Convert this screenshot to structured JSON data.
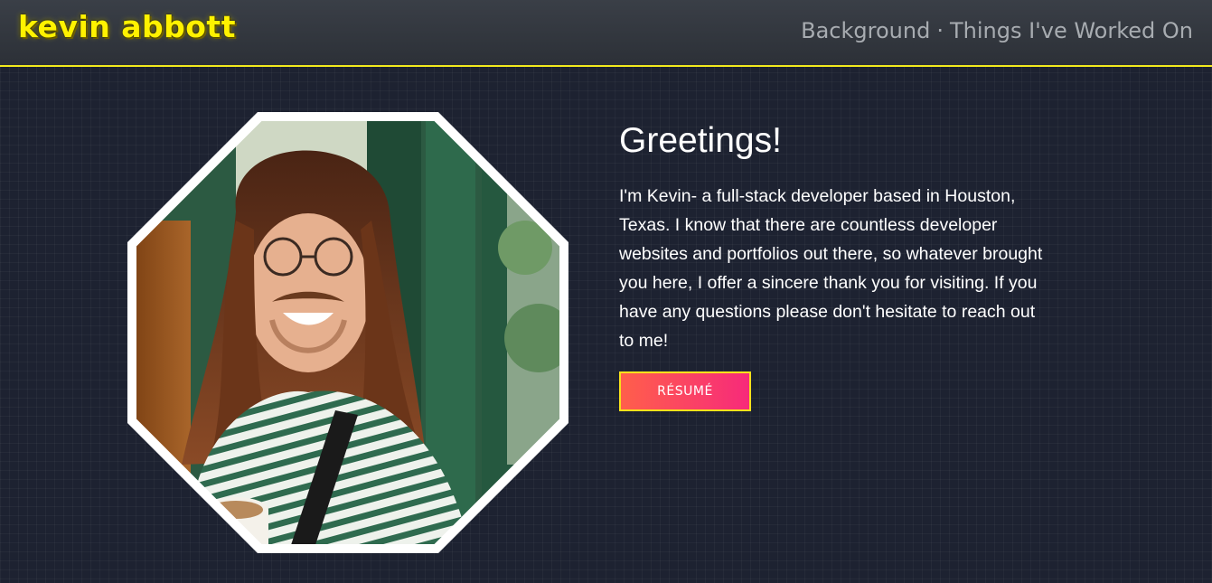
{
  "header": {
    "logo_text": "kevin abbott",
    "nav": {
      "items": [
        {
          "label": "Background"
        },
        {
          "label": "Things I've Worked On"
        }
      ],
      "separator": "·"
    }
  },
  "main": {
    "photo": {
      "description": "octagonal-profile-photo"
    },
    "greeting": "Greetings!",
    "intro": "I'm Kevin- a full-stack developer based in Houston, Texas. I know that there are countless developer websites and portfolios out there, so whatever brought you here, I offer a sincere thank you for visiting. If you have any questions please don't hesitate to reach out to me!",
    "resume_button": "RÉSUMÉ"
  },
  "colors": {
    "accent_yellow": "#f2ea1d",
    "background": "#1d2231",
    "button_gradient_start": "#ff5f4b",
    "button_gradient_end": "#f72a7a",
    "nav_text": "#a8acb1"
  }
}
